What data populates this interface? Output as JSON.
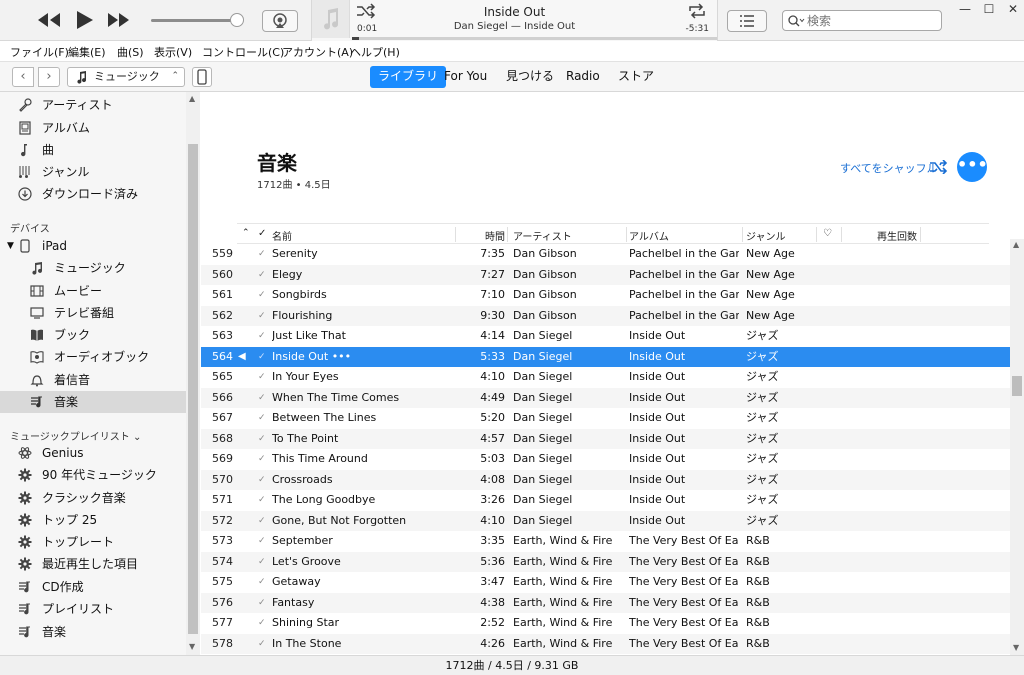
{
  "player": {
    "now_playing_title": "Inside Out",
    "now_playing_subtitle": "Dan Siegel — Inside Out",
    "elapsed": "0:01",
    "remaining": "-5:31",
    "volume_level": 0.9,
    "progress_fraction": 0.003
  },
  "search": {
    "placeholder": "検索"
  },
  "menu": [
    "ファイル(F)",
    "編集(E)",
    "曲(S)",
    "表示(V)",
    "コントロール(C)",
    "アカウント(A)",
    "ヘルプ(H)"
  ],
  "nav": {
    "media_kind": "ミュージック",
    "tabs": [
      {
        "label": "ライブラリ",
        "active": true
      },
      {
        "label": "For You",
        "active": false
      },
      {
        "label": "見つける",
        "active": false
      },
      {
        "label": "Radio",
        "active": false
      },
      {
        "label": "ストア",
        "active": false
      }
    ]
  },
  "sidebar": {
    "library": [
      {
        "label": "アーティスト",
        "icon": "microphone-icon"
      },
      {
        "label": "アルバム",
        "icon": "album-icon"
      },
      {
        "label": "曲",
        "icon": "music-note-icon"
      },
      {
        "label": "ジャンル",
        "icon": "genre-icon"
      },
      {
        "label": "ダウンロード済み",
        "icon": "download-icon"
      }
    ],
    "devices_header": "デバイス",
    "device_name": "iPad",
    "device_items": [
      {
        "label": "ミュージック",
        "icon": "music-note-icon"
      },
      {
        "label": "ムービー",
        "icon": "film-icon"
      },
      {
        "label": "テレビ番組",
        "icon": "tv-icon"
      },
      {
        "label": "ブック",
        "icon": "book-icon"
      },
      {
        "label": "オーディオブック",
        "icon": "audiobook-icon"
      },
      {
        "label": "着信音",
        "icon": "bell-icon"
      },
      {
        "label": "音楽",
        "icon": "playlist-icon",
        "selected": true
      }
    ],
    "playlists_header": "ミュージックプレイリスト",
    "playlists": [
      {
        "label": "Genius",
        "icon": "genius-icon"
      },
      {
        "label": "90 年代ミュージック",
        "icon": "gear-icon"
      },
      {
        "label": "クラシック音楽",
        "icon": "gear-icon"
      },
      {
        "label": "トップ 25",
        "icon": "gear-icon"
      },
      {
        "label": "トップレート",
        "icon": "gear-icon"
      },
      {
        "label": "最近再生した項目",
        "icon": "gear-icon"
      },
      {
        "label": "CD作成",
        "icon": "playlist-icon"
      },
      {
        "label": "プレイリスト",
        "icon": "playlist-icon"
      },
      {
        "label": "音楽",
        "icon": "playlist-icon"
      }
    ]
  },
  "main": {
    "title": "音楽",
    "subtitle": "1712曲 • 4.5日",
    "shuffle_all": "すべてをシャッフル",
    "more_label": "•••",
    "columns": {
      "check": "✓",
      "name": "名前",
      "time": "時間",
      "artist": "アーティスト",
      "album": "アルバム",
      "genre": "ジャンル",
      "heart": "♡",
      "plays": "再生回数"
    },
    "rows": [
      {
        "num": "559",
        "name": "Serenity",
        "time": "7:35",
        "artist": "Dan Gibson",
        "album": "Pachelbel in the Gar...",
        "genre": "New Age"
      },
      {
        "num": "560",
        "name": "Elegy",
        "time": "7:27",
        "artist": "Dan Gibson",
        "album": "Pachelbel in the Gar...",
        "genre": "New Age"
      },
      {
        "num": "561",
        "name": "Songbirds",
        "time": "7:10",
        "artist": "Dan Gibson",
        "album": "Pachelbel in the Gar...",
        "genre": "New Age"
      },
      {
        "num": "562",
        "name": "Flourishing",
        "time": "9:30",
        "artist": "Dan Gibson",
        "album": "Pachelbel in the Gar...",
        "genre": "New Age"
      },
      {
        "num": "563",
        "name": "Just Like That",
        "time": "4:14",
        "artist": "Dan Siegel",
        "album": "Inside Out",
        "genre": "ジャズ"
      },
      {
        "num": "564",
        "name": "Inside Out  •••",
        "time": "5:33",
        "artist": "Dan Siegel",
        "album": "Inside Out",
        "genre": "ジャズ",
        "playing": true
      },
      {
        "num": "565",
        "name": "In Your Eyes",
        "time": "4:10",
        "artist": "Dan Siegel",
        "album": "Inside Out",
        "genre": "ジャズ"
      },
      {
        "num": "566",
        "name": "When The Time Comes",
        "time": "4:49",
        "artist": "Dan Siegel",
        "album": "Inside Out",
        "genre": "ジャズ"
      },
      {
        "num": "567",
        "name": "Between The Lines",
        "time": "5:20",
        "artist": "Dan Siegel",
        "album": "Inside Out",
        "genre": "ジャズ"
      },
      {
        "num": "568",
        "name": "To The Point",
        "time": "4:57",
        "artist": "Dan Siegel",
        "album": "Inside Out",
        "genre": "ジャズ"
      },
      {
        "num": "569",
        "name": "This Time Around",
        "time": "5:03",
        "artist": "Dan Siegel",
        "album": "Inside Out",
        "genre": "ジャズ"
      },
      {
        "num": "570",
        "name": "Crossroads",
        "time": "4:08",
        "artist": "Dan Siegel",
        "album": "Inside Out",
        "genre": "ジャズ"
      },
      {
        "num": "571",
        "name": "The Long Goodbye",
        "time": "3:26",
        "artist": "Dan Siegel",
        "album": "Inside Out",
        "genre": "ジャズ"
      },
      {
        "num": "572",
        "name": "Gone, But Not Forgotten",
        "time": "4:10",
        "artist": "Dan Siegel",
        "album": "Inside Out",
        "genre": "ジャズ"
      },
      {
        "num": "573",
        "name": "September",
        "time": "3:35",
        "artist": "Earth, Wind & Fire",
        "album": "The Very Best Of Ear...",
        "genre": "R&B"
      },
      {
        "num": "574",
        "name": "Let's Groove",
        "time": "5:36",
        "artist": "Earth, Wind & Fire",
        "album": "The Very Best Of Ear...",
        "genre": "R&B"
      },
      {
        "num": "575",
        "name": "Getaway",
        "time": "3:47",
        "artist": "Earth, Wind & Fire",
        "album": "The Very Best Of Ear...",
        "genre": "R&B"
      },
      {
        "num": "576",
        "name": "Fantasy",
        "time": "4:38",
        "artist": "Earth, Wind & Fire",
        "album": "The Very Best Of Ear...",
        "genre": "R&B"
      },
      {
        "num": "577",
        "name": "Shining Star",
        "time": "2:52",
        "artist": "Earth, Wind & Fire",
        "album": "The Very Best Of Ear...",
        "genre": "R&B"
      },
      {
        "num": "578",
        "name": "In The Stone",
        "time": "4:26",
        "artist": "Earth, Wind & Fire",
        "album": "The Very Best Of Ear...",
        "genre": "R&B"
      }
    ]
  },
  "status": {
    "summary": "1712曲 / 4.5日 / 9.31 GB"
  },
  "colors": {
    "accent": "#1a8cff",
    "selected_row": "#2b8cf0",
    "link": "#1a6fd4"
  }
}
